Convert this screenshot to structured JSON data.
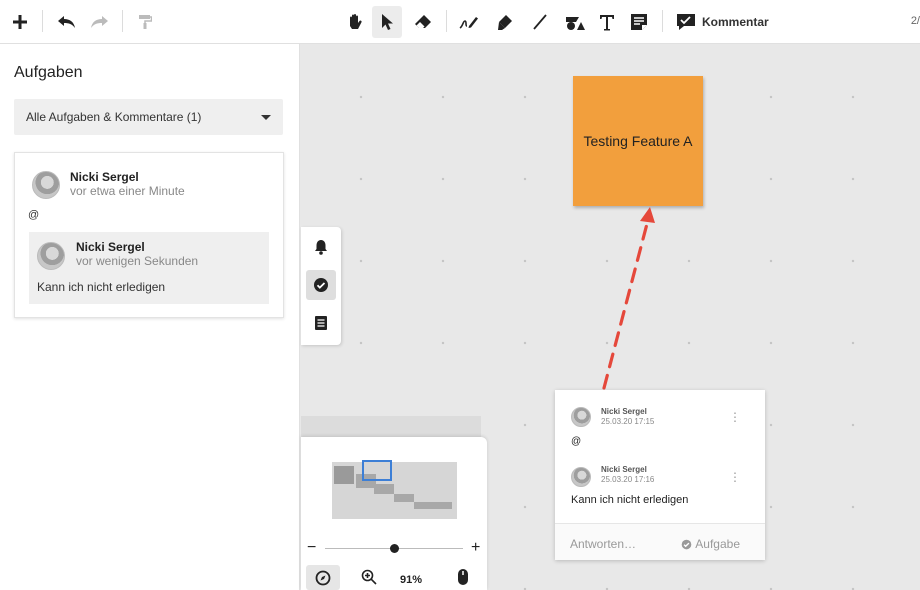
{
  "toolbar": {
    "comment_label": "Kommentar",
    "page_indicator": "2/"
  },
  "panel": {
    "title": "Aufgaben",
    "filter_label": "Alle Aufgaben & Kommentare (1)",
    "comment": {
      "author": "Nicki Sergel",
      "time": "vor etwa einer Minute",
      "text": "@"
    },
    "reply": {
      "author": "Nicki Sergel",
      "time": "vor wenigen Sekunden",
      "text": "Kann ich nicht erledigen"
    }
  },
  "canvas": {
    "sticky_text": "Testing Feature A",
    "sticky_color": "#f29f3d",
    "arrow_color": "#e5483b"
  },
  "navigator": {
    "zoom_minus": "−",
    "zoom_plus": "+",
    "zoom_percent": "91%",
    "zoom_level": 0.5
  },
  "popup": {
    "comments": [
      {
        "author": "Nicki Sergel",
        "time": "25.03.20 17:15",
        "text": "@"
      },
      {
        "author": "Nicki Sergel",
        "time": "25.03.20 17:16",
        "text": "Kann ich nicht erledigen"
      }
    ],
    "reply_placeholder": "Antworten…",
    "task_label": "Aufgabe"
  },
  "icons": [
    "plus-icon",
    "undo-icon",
    "redo-icon",
    "paint-roller-icon",
    "hand-icon",
    "pointer-icon",
    "eraser-icon",
    "pen-icon",
    "marker-icon",
    "line-icon",
    "shapes-icon",
    "text-icon",
    "note-icon",
    "comment-icon",
    "bell-icon",
    "check-circle-icon",
    "list-icon",
    "compass-icon",
    "zoom-in-icon",
    "mouse-icon",
    "check-circle-small-icon",
    "more-icon"
  ]
}
